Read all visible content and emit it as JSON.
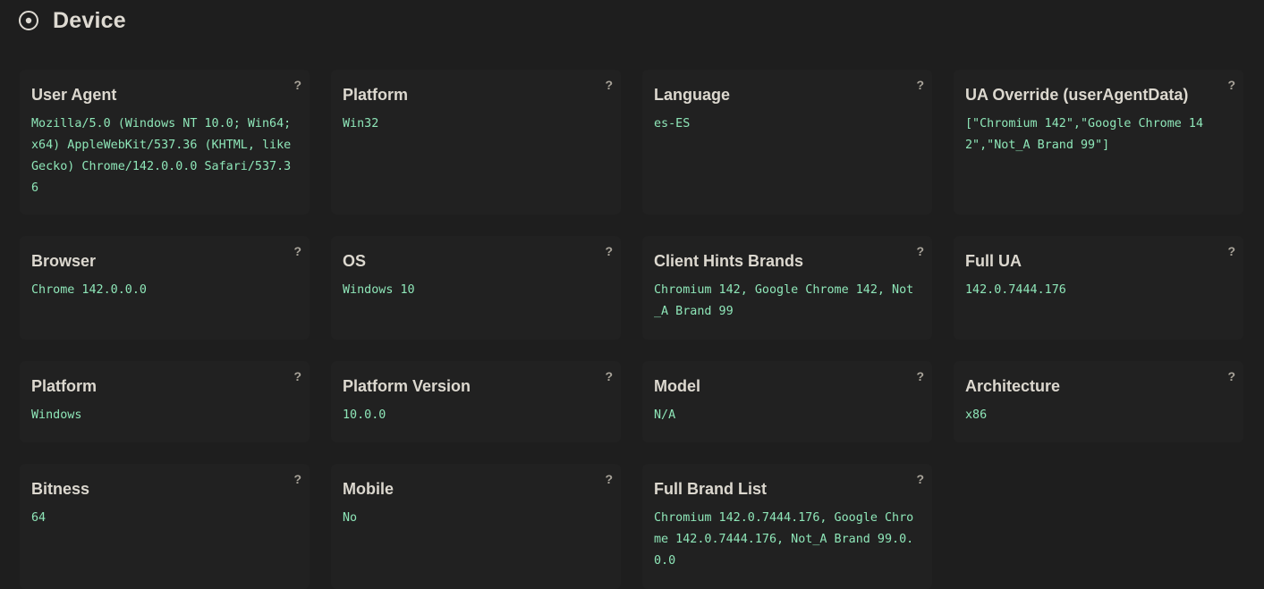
{
  "section": {
    "title": "Device",
    "icon": "target-icon"
  },
  "colors": {
    "background": "#1e1e1e",
    "card": "#212121",
    "title": "#dcd8cf",
    "value": "#8ee6b8",
    "help": "#a9a49a"
  },
  "cards": [
    {
      "title": "User Agent",
      "help": "?",
      "value": "Mozilla/5.0 (Windows NT 10.0; Win64; x64) AppleWebKit/537.36 (KHTML, like Gecko) Chrome/142.0.0.0 Safari/537.36"
    },
    {
      "title": "Platform",
      "help": "?",
      "value": "Win32"
    },
    {
      "title": "Language",
      "help": "?",
      "value": "es-ES"
    },
    {
      "title": "UA Override (userAgentData)",
      "help": "?",
      "value": "[\"Chromium 142\",\"Google Chrome 142\",\"Not_A Brand 99\"]"
    },
    {
      "title": "Browser",
      "help": "?",
      "value": "Chrome 142.0.0.0"
    },
    {
      "title": "OS",
      "help": "?",
      "value": "Windows 10"
    },
    {
      "title": "Client Hints Brands",
      "help": "?",
      "value": "Chromium 142, Google Chrome 142, Not_A Brand 99"
    },
    {
      "title": "Full UA",
      "help": "?",
      "value": "142.0.7444.176"
    },
    {
      "title": "Platform",
      "help": "?",
      "value": "Windows"
    },
    {
      "title": "Platform Version",
      "help": "?",
      "value": "10.0.0"
    },
    {
      "title": "Model",
      "help": "?",
      "value": "N/A"
    },
    {
      "title": "Architecture",
      "help": "?",
      "value": "x86"
    },
    {
      "title": "Bitness",
      "help": "?",
      "value": "64"
    },
    {
      "title": "Mobile",
      "help": "?",
      "value": "No"
    },
    {
      "title": "Full Brand List",
      "help": "?",
      "value": "Chromium 142.0.7444.176, Google Chrome 142.0.7444.176, Not_A Brand 99.0.0.0"
    }
  ]
}
